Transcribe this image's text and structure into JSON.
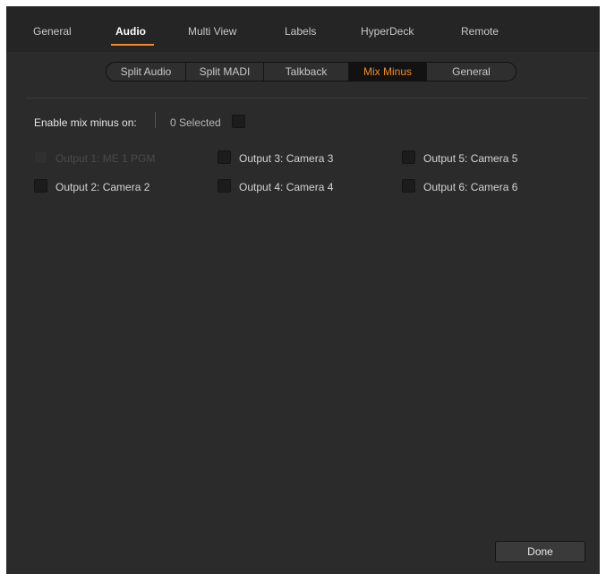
{
  "top_tabs": [
    {
      "label": "General"
    },
    {
      "label": "Audio"
    },
    {
      "label": "Multi View"
    },
    {
      "label": "Labels"
    },
    {
      "label": "HyperDeck"
    },
    {
      "label": "Remote"
    }
  ],
  "active_top_tab": "Audio",
  "sub_tabs": [
    {
      "label": "Split Audio"
    },
    {
      "label": "Split MADI"
    },
    {
      "label": "Talkback"
    },
    {
      "label": "Mix Minus"
    },
    {
      "label": "General"
    }
  ],
  "active_sub_tab": "Mix Minus",
  "mix_minus": {
    "enable_label": "Enable mix minus on:",
    "selected_text": "0 Selected",
    "select_all_checked": false
  },
  "outputs": [
    {
      "label": "Output 1: ME 1 PGM",
      "checked": false,
      "enabled": false
    },
    {
      "label": "Output 2: Camera 2",
      "checked": false,
      "enabled": true
    },
    {
      "label": "Output 3: Camera 3",
      "checked": false,
      "enabled": true
    },
    {
      "label": "Output 4: Camera 4",
      "checked": false,
      "enabled": true
    },
    {
      "label": "Output 5: Camera 5",
      "checked": false,
      "enabled": true
    },
    {
      "label": "Output 6: Camera 6",
      "checked": false,
      "enabled": true
    }
  ],
  "done_label": "Done",
  "colors": {
    "accent": "#f28c28",
    "panel_bg": "#2b2b2b",
    "nav_bg": "#252525"
  }
}
